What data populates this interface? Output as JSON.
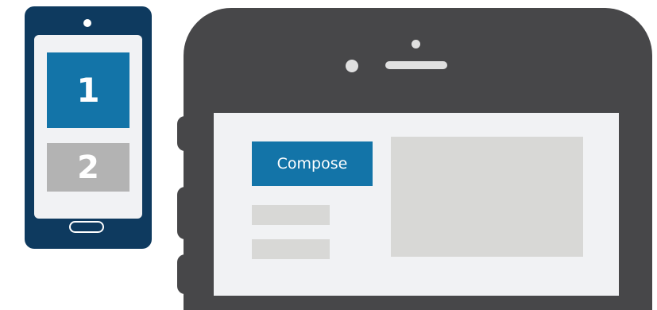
{
  "small_phone": {
    "tiles": [
      {
        "label": "1",
        "color": "#1374a8"
      },
      {
        "label": "2",
        "color": "#b3b3b3"
      }
    ],
    "body_color": "#0e3a5f"
  },
  "big_phone": {
    "body_color": "#474749",
    "screen": {
      "compose_button_label": "Compose",
      "accent": "#1374a8",
      "placeholder_color": "#d8d8d6"
    }
  }
}
